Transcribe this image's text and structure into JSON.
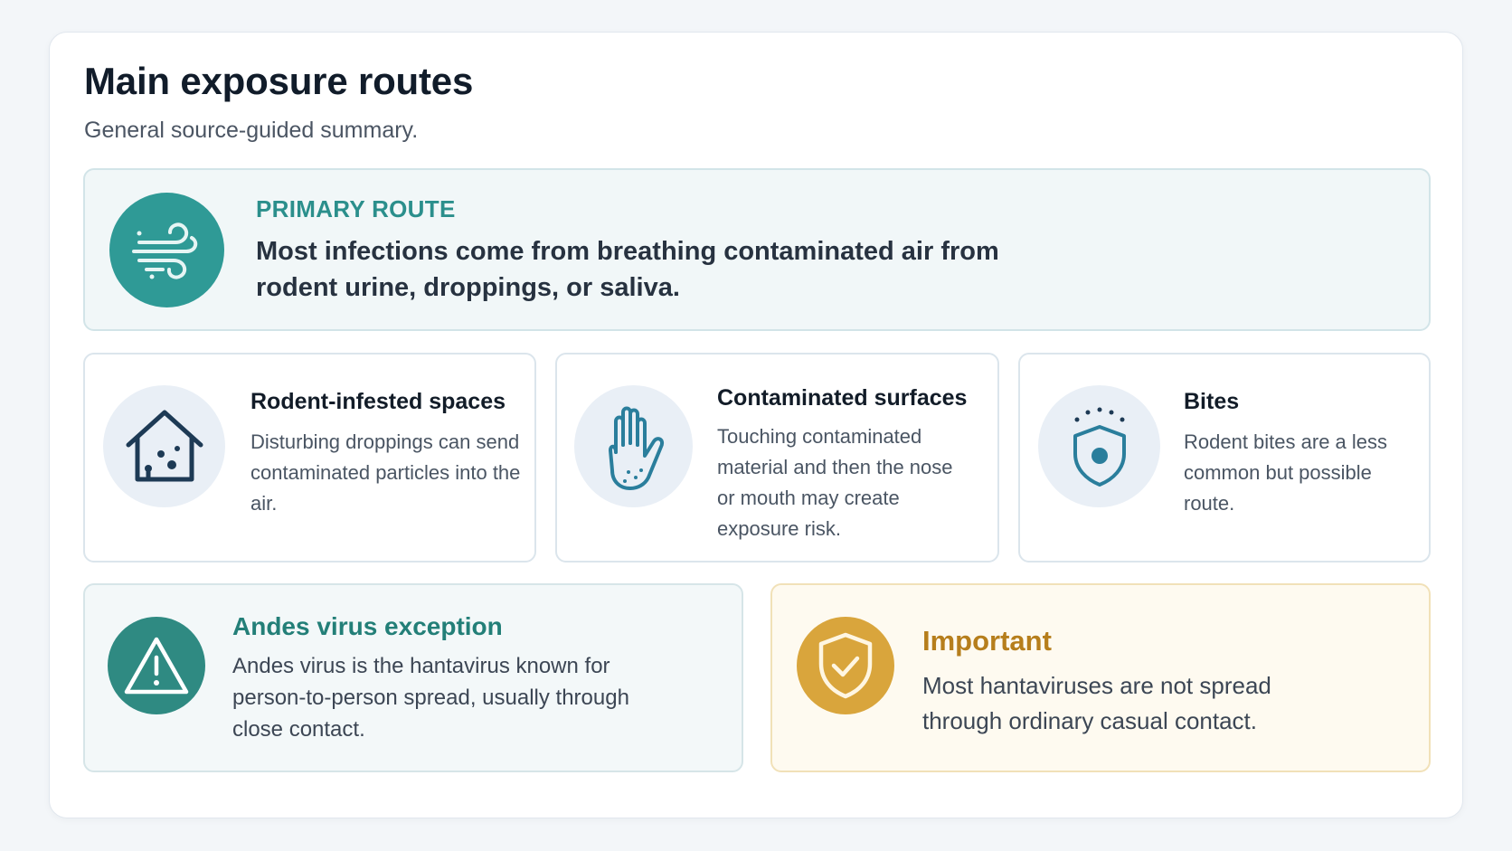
{
  "page": {
    "title": "Main exposure routes",
    "subtitle": "General source-guided summary."
  },
  "primary": {
    "label": "PRIMARY ROUTE",
    "text": "Most infections come from breathing contaminated air from rodent urine, droppings, or saliva.",
    "icon": "wind-icon"
  },
  "routes": [
    {
      "title": "Rodent-infested spaces",
      "text": "Disturbing droppings can send contaminated particles into the air.",
      "icon": "house-icon"
    },
    {
      "title": "Contaminated surfaces",
      "text": "Touching contaminated material and then the nose or mouth may create exposure risk.",
      "icon": "hand-icon"
    },
    {
      "title": "Bites",
      "text": "Rodent bites are a less common but possible route.",
      "icon": "shield-icon"
    }
  ],
  "andes": {
    "title": "Andes virus exception",
    "text": "Andes virus is the hantavirus known for person-to-person spread, usually through close contact.",
    "icon": "warning-icon"
  },
  "important": {
    "title": "Important",
    "text": "Most hantaviruses are not spread through ordinary casual contact.",
    "icon": "shield-check-icon"
  },
  "colors": {
    "teal": "#2f9a96",
    "gold": "#d9a53c",
    "navy": "#1d3a55"
  }
}
